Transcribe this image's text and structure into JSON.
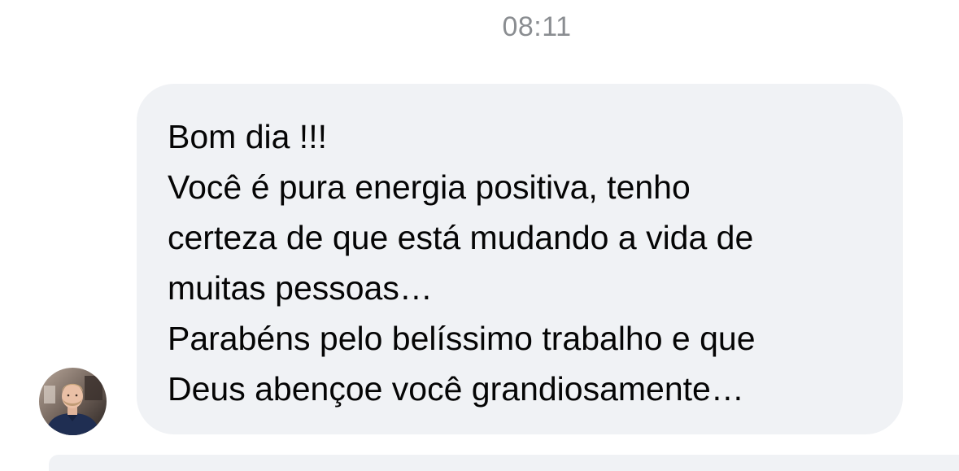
{
  "thread": {
    "timestamp": "08:11"
  },
  "message": {
    "lines": [
      "Bom dia !!!",
      "Você é pura energia positiva, tenho",
      "certeza de que está mudando a vida de",
      "muitas pessoas…",
      "Parabéns pelo belíssimo trabalho e que",
      "Deus abençoe você grandiosamente…"
    ]
  },
  "sender": {
    "avatar_icon": "user-avatar"
  },
  "colors": {
    "bubble_bg": "#f0f2f5",
    "timestamp_text": "#8a8d91",
    "message_text": "#050505"
  }
}
